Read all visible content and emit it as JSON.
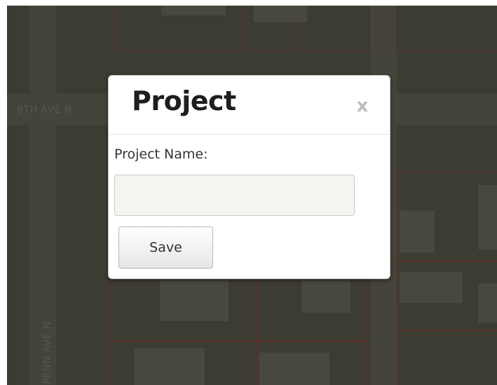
{
  "map": {
    "street_labels": {
      "horizontal": "8TH AVE N",
      "vertical": "PENN AVE N"
    }
  },
  "modal": {
    "title": "Project",
    "close_label": "x",
    "field": {
      "label": "Project Name:",
      "value": "",
      "placeholder": ""
    },
    "save_label": "Save"
  }
}
